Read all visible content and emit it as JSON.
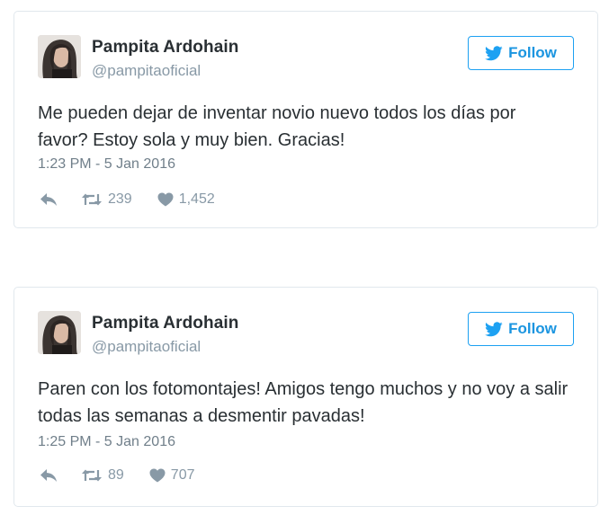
{
  "tweets": [
    {
      "name": "Pampita Ardohain",
      "handle": "@pampitaoficial",
      "follow_label": "Follow",
      "text": "Me pueden dejar de inventar novio nuevo todos los días por favor? Estoy sola y muy bien. Gracias!",
      "timestamp": "1:23 PM - 5 Jan 2016",
      "retweets": "239",
      "likes": "1,452"
    },
    {
      "name": "Pampita Ardohain",
      "handle": "@pampitaoficial",
      "follow_label": "Follow",
      "text": "Paren con los fotomontajes! Amigos tengo muchos y no voy a salir todas las semanas a desmentir pavadas!",
      "timestamp": "1:25 PM - 5 Jan 2016",
      "retweets": "89",
      "likes": "707"
    }
  ],
  "icons": {
    "follow": "twitter-bird-icon",
    "reply": "reply-icon",
    "retweet": "retweet-icon",
    "like": "heart-icon"
  },
  "colors": {
    "accent": "#1da1f2",
    "border": "#e1e8ed",
    "muted": "#8899a6",
    "text": "#292f33"
  }
}
